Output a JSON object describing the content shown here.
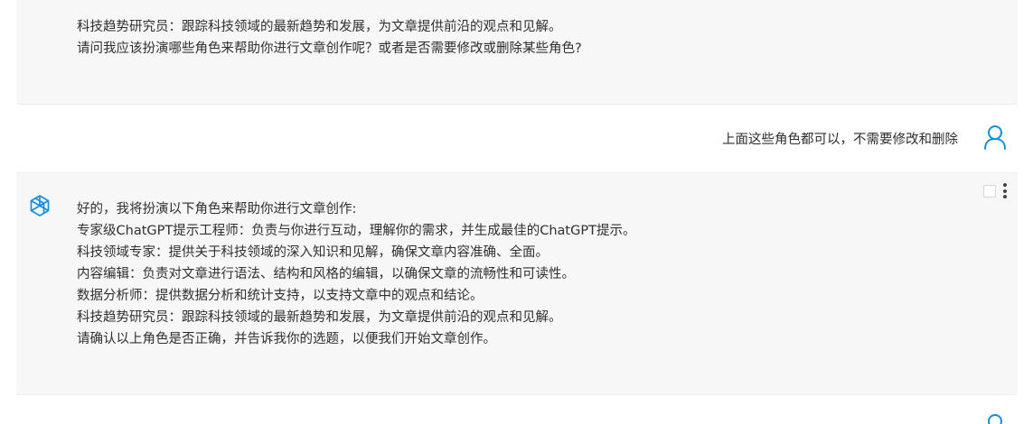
{
  "conversation": {
    "msg1": {
      "lines": [
        "科技趋势研究员：跟踪科技领域的最新趋势和发展，为文章提供前沿的观点和见解。",
        "请问我应该扮演哪些角色来帮助你进行文章创作呢？或者是否需要修改或删除某些角色?"
      ]
    },
    "user": {
      "text": "上面这些角色都可以，不需要修改和删除"
    },
    "msg2": {
      "lines": [
        "好的，我将扮演以下角色来帮助你进行文章创作:",
        "专家级ChatGPT提示工程师：负责与你进行互动，理解你的需求，并生成最佳的ChatGPT提示。",
        "科技领域专家：提供关于科技领域的深入知识和见解，确保文章内容准确、全面。",
        "内容编辑：负责对文章进行语法、结构和风格的编辑，以确保文章的流畅性和可读性。",
        "数据分析师：提供数据分析和统计支持，以支持文章中的观点和结论。",
        "科技趋势研究员：跟踪科技领域的最新趋势和发展，为文章提供前沿的观点和见解。",
        "请确认以上角色是否正确，并告诉我你的选题，以便我们开始文章创作。"
      ]
    }
  },
  "colors": {
    "ai_bg": "#f7f7f8",
    "user_bg": "#ffffff",
    "user_icon": "#1a8fd9",
    "ai_icon": "#1a8fd9"
  },
  "icons": {
    "user": "user-outline-icon",
    "assistant": "openai-logo-icon",
    "menu": "more-vertical-icon"
  }
}
